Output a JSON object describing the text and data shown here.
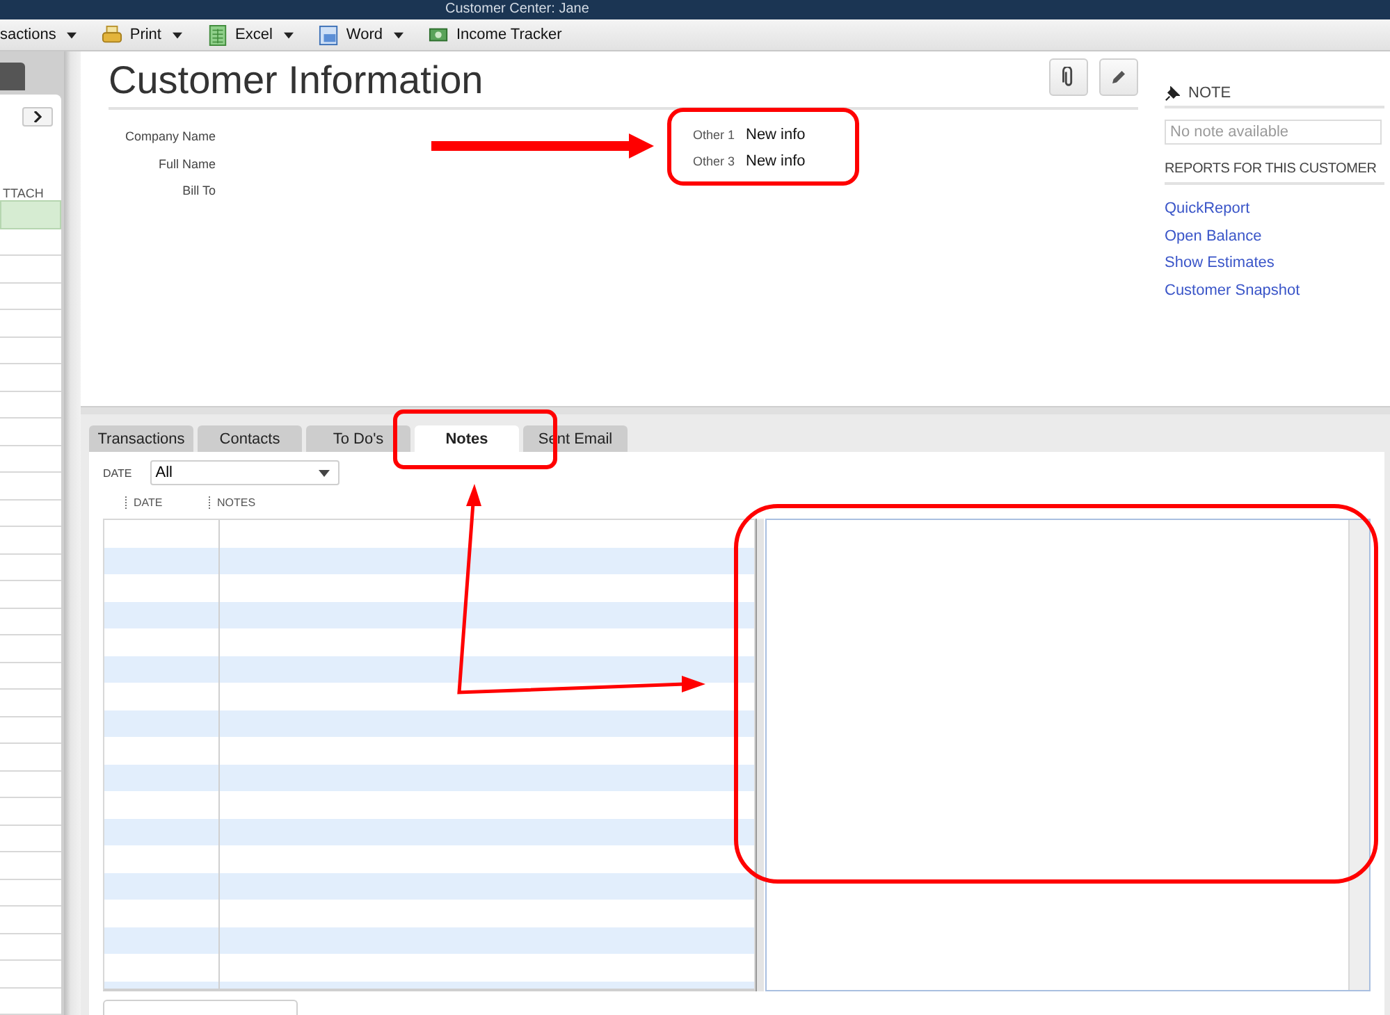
{
  "window": {
    "title": "Customer Center: Jane"
  },
  "toolbar": [
    {
      "kind": "menu",
      "label": "sactions",
      "dropdown": true
    },
    {
      "kind": "print",
      "label": "Print",
      "dropdown": true
    },
    {
      "kind": "excel",
      "label": "Excel",
      "dropdown": true
    },
    {
      "kind": "word",
      "label": "Word",
      "dropdown": true
    },
    {
      "kind": "tracker",
      "label": "Income Tracker",
      "dropdown": false
    }
  ],
  "sidebar": {
    "column_header": "TTACH",
    "rows": [
      {
        "selected": true
      },
      {
        "selected": false
      },
      {
        "selected": false
      },
      {
        "selected": false
      },
      {
        "selected": false
      },
      {
        "selected": false
      },
      {
        "selected": false
      },
      {
        "selected": false
      },
      {
        "selected": false
      },
      {
        "selected": false
      },
      {
        "selected": false
      },
      {
        "selected": false
      },
      {
        "selected": false
      },
      {
        "selected": false
      },
      {
        "selected": false
      },
      {
        "selected": false
      },
      {
        "selected": false
      },
      {
        "selected": false
      },
      {
        "selected": false
      },
      {
        "selected": false
      },
      {
        "selected": false
      },
      {
        "selected": false
      },
      {
        "selected": false
      },
      {
        "selected": false
      },
      {
        "selected": false
      },
      {
        "selected": false
      },
      {
        "selected": false
      },
      {
        "selected": false
      },
      {
        "selected": false
      },
      {
        "selected": false
      }
    ]
  },
  "customer": {
    "title": "Customer Information",
    "fields": [
      {
        "label": "Company Name"
      },
      {
        "label": "Full Name"
      },
      {
        "label": "Bill To"
      }
    ],
    "custom_fields": [
      {
        "label": "Other 1",
        "value": "New info"
      },
      {
        "label": "Other 3",
        "value": "New info"
      }
    ]
  },
  "note": {
    "heading": "NOTE",
    "placeholder": "No note available"
  },
  "reports": {
    "heading": "REPORTS FOR THIS CUSTOMER",
    "links": [
      "QuickReport",
      "Open Balance",
      "Show Estimates",
      "Customer Snapshot"
    ]
  },
  "tabs": [
    {
      "label": "Transactions",
      "selected": false
    },
    {
      "label": "Contacts",
      "selected": false
    },
    {
      "label": "To Do's",
      "selected": false
    },
    {
      "label": "Notes",
      "selected": true
    },
    {
      "label": "Sent Email",
      "selected": false
    }
  ],
  "filter": {
    "label": "DATE",
    "value": "All"
  },
  "table": {
    "columns": [
      "DATE",
      "NOTES"
    ]
  }
}
